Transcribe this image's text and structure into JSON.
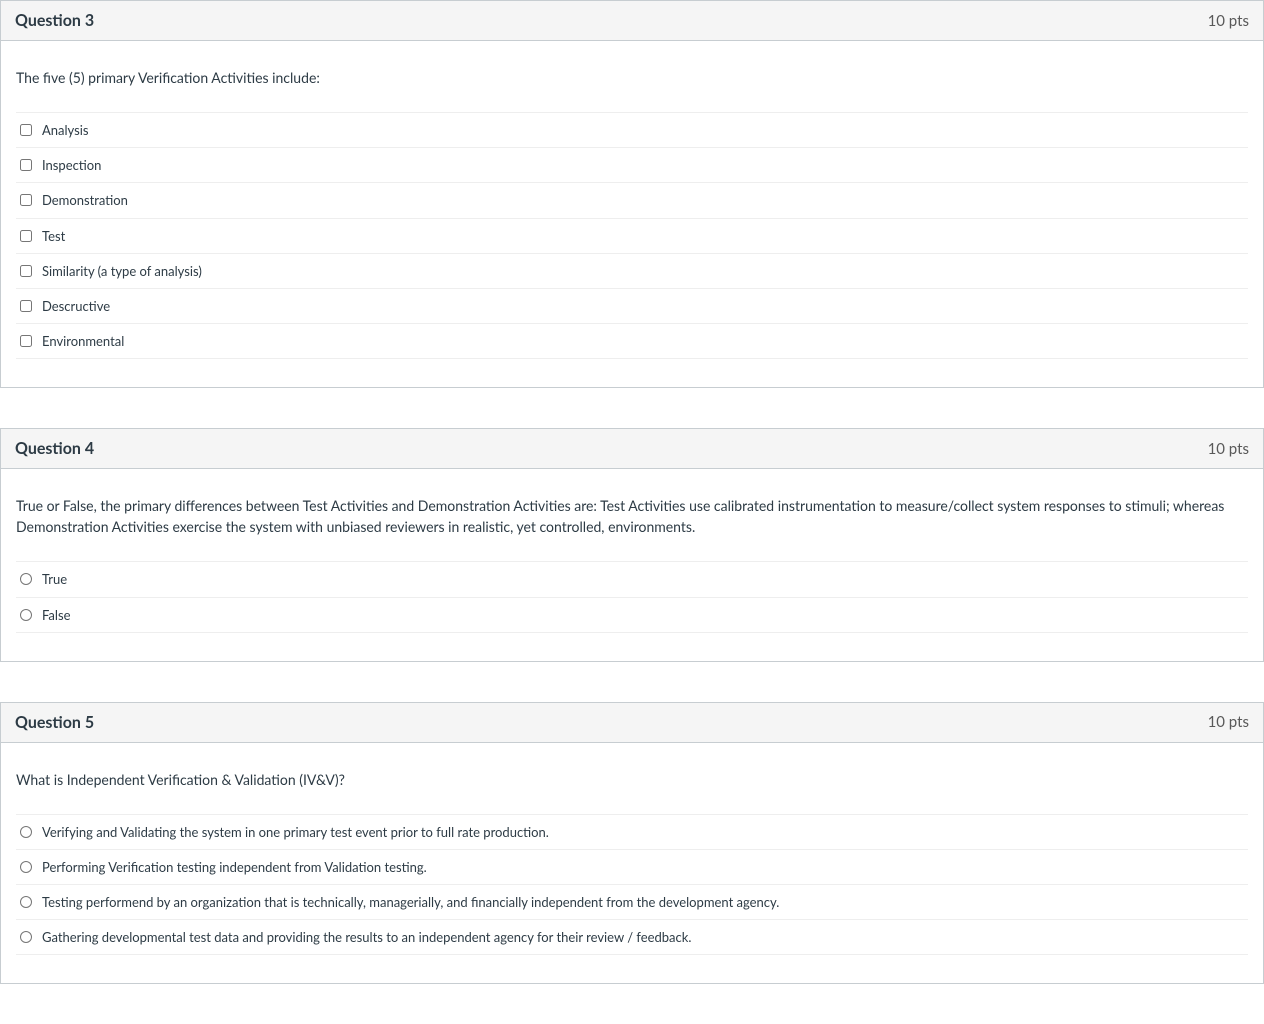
{
  "questions": [
    {
      "title": "Question 3",
      "points": "10 pts",
      "text": "The five (5) primary Verification Activities include:",
      "input_type": "checkbox",
      "options": [
        "Analysis",
        "Inspection",
        "Demonstration",
        "Test",
        "Similarity (a type of analysis)",
        "Descructive",
        "Environmental"
      ]
    },
    {
      "title": "Question 4",
      "points": "10 pts",
      "text": "True or False, the primary differences between Test Activities and Demonstration Activities are: Test Activities use calibrated instrumentation to measure/collect system responses to stimuli; whereas Demonstration Activities exercise the system with unbiased reviewers in realistic, yet controlled, environments.",
      "input_type": "radio",
      "options": [
        "True",
        "False"
      ]
    },
    {
      "title": "Question 5",
      "points": "10 pts",
      "text": "What is Independent Verification & Validation (IV&V)?",
      "input_type": "radio",
      "options": [
        "Verifying and Validating the system in one primary test event prior to full rate production.",
        "Performing Verification testing independent from Validation testing.",
        "Testing performend by an organization that is technically, managerially, and financially independent from the development agency.",
        "Gathering developmental test data and providing the results to an independent agency for their review / feedback."
      ]
    }
  ]
}
